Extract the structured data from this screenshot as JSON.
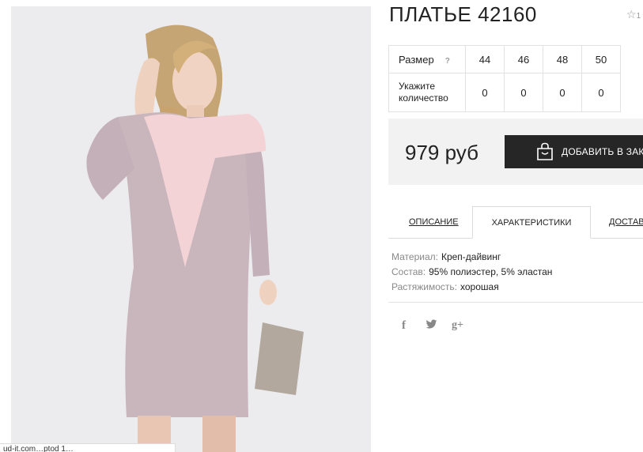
{
  "product": {
    "title": "ПЛАТЬЕ 42160",
    "favorite_count": "1"
  },
  "sizes": {
    "size_label": "Размер",
    "help_mark": "?",
    "qty_label_line1": "Укажите",
    "qty_label_line2": "количество",
    "items": [
      {
        "size": "44",
        "qty": "0"
      },
      {
        "size": "46",
        "qty": "0"
      },
      {
        "size": "48",
        "qty": "0"
      },
      {
        "size": "50",
        "qty": "0"
      }
    ]
  },
  "price": {
    "amount": "979 руб",
    "add_to_cart_label": "ДОБАВИТЬ В ЗАКАЗ"
  },
  "tabs": {
    "description": "ОПИСАНИЕ",
    "characteristics": "ХАРАКТЕРИСТИКИ",
    "delivery": "ДОСТАВКА",
    "active": "characteristics"
  },
  "specs": [
    {
      "key": "Материал:",
      "value": "Креп-дайвинг"
    },
    {
      "key": "Состав:",
      "value": "95% полиэстер, 5% эластан"
    },
    {
      "key": "Растяжимость:",
      "value": "хорошая"
    }
  ],
  "social": {
    "facebook": "f",
    "twitter": "twitter-icon",
    "googleplus": "g+"
  },
  "status_bar": {
    "text": "ud-it.com…ptod 1…"
  },
  "colors": {
    "dress": "#c9b6bd",
    "dress_accent": "#f3d3d6",
    "button": "#262626",
    "price_bg": "#f2f2f2"
  }
}
